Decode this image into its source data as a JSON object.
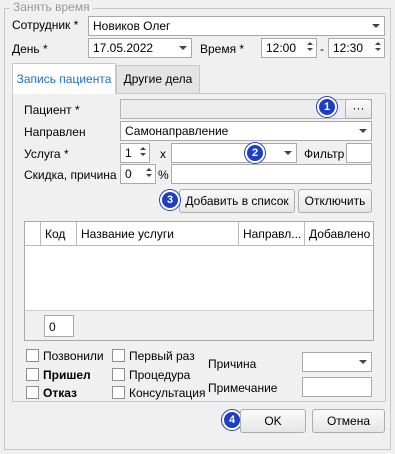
{
  "dialog": {
    "group_title": "Занять время",
    "employee_label": "Сотрудник *",
    "employee_value": "Новиков Олег",
    "day_label": "День *",
    "day_value": "17.05.2022",
    "time_label": "Время *",
    "time_from": "12:00",
    "time_sep": "-",
    "time_to": "12:30"
  },
  "tabs": [
    {
      "label": "Запись пациента",
      "active": true
    },
    {
      "label": "Другие дела",
      "active": false
    }
  ],
  "form": {
    "patient_label": "Пациент *",
    "patient_value": "",
    "patient_button": "···",
    "referral_label": "Направлен",
    "referral_value": "Самонаправление",
    "service_label": "Услуга *",
    "service_qty": "1",
    "service_x": "x",
    "service_value": "",
    "filter_label": "Фильтр",
    "filter_value": "",
    "discount_label": "Скидка, причина",
    "discount_value": "0",
    "discount_unit": "%",
    "discount_reason": ""
  },
  "buttons": {
    "add_to_list": "Добавить в список",
    "disable": "Отключить",
    "ok": "OK",
    "cancel": "Отмена"
  },
  "grid": {
    "columns": [
      "",
      "Код",
      "Название услуги",
      "Направл...",
      "Добавлено"
    ],
    "rows": [],
    "footer_count": "0"
  },
  "checkboxes": {
    "called": "Позвонили",
    "came": "Пришел",
    "refusal": "Отказ",
    "first_time": "Первый раз",
    "procedure": "Процедура",
    "consultation": "Консультация"
  },
  "extra": {
    "reason_label": "Причина",
    "reason_value": "",
    "note_label": "Примечание",
    "note_value": ""
  },
  "badges": [
    "1",
    "2",
    "3",
    "4"
  ],
  "colors": {
    "badge": "#1e3fbf",
    "active_tab_text": "#1a6fd6"
  }
}
